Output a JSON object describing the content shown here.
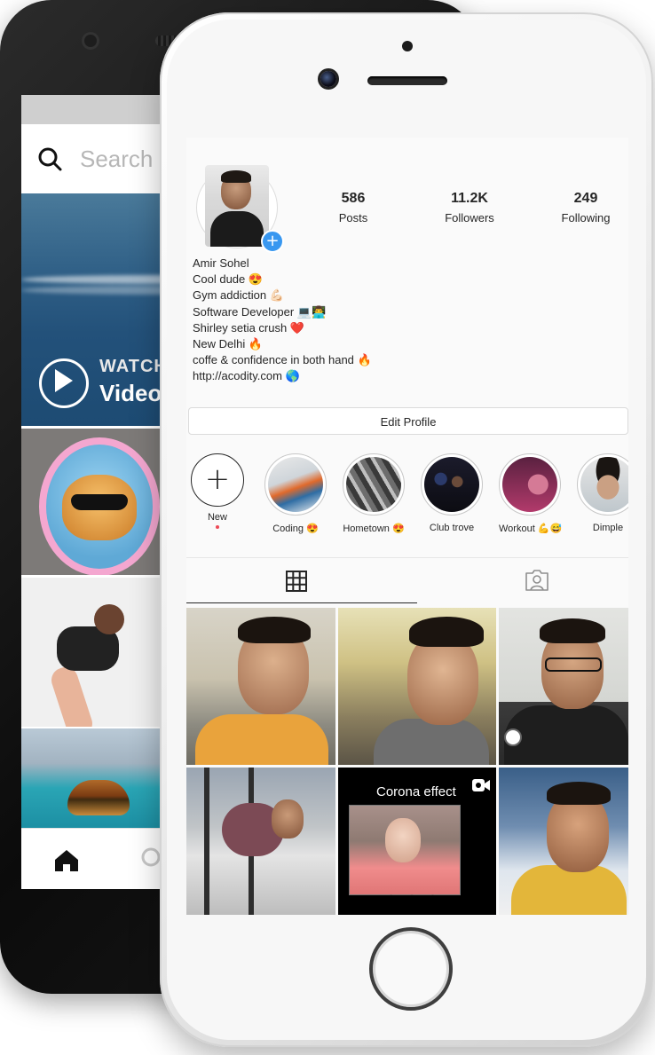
{
  "back_phone": {
    "search_placeholder": "Search",
    "video_overlay": {
      "watch": "WATCH",
      "title": "Video"
    }
  },
  "profile": {
    "stats": [
      {
        "value": "586",
        "label": "Posts"
      },
      {
        "value": "11.2K",
        "label": "Followers"
      },
      {
        "value": "249",
        "label": "Following"
      }
    ],
    "bio": [
      "Amir Sohel",
      "Cool dude 😍",
      "Gym addiction 💪🏻",
      "Software Developer 💻👨‍💻",
      "Shirley setia crush ❤️",
      "New Delhi 🔥",
      "coffe & confidence in both hand 🔥",
      "http://acodity.com 🌎"
    ],
    "edit_button": "Edit Profile",
    "highlights": [
      {
        "label": "New"
      },
      {
        "label": "Coding 😍"
      },
      {
        "label": "Hometown 😍"
      },
      {
        "label": "Club trove"
      },
      {
        "label": "Workout 💪😅"
      },
      {
        "label": "Dimple"
      }
    ],
    "tabs": [
      {
        "name": "grid",
        "icon": "grid-icon",
        "active": true
      },
      {
        "name": "tagged",
        "icon": "tagged-person-icon",
        "active": false
      }
    ],
    "posts": [
      {
        "caption": ""
      },
      {
        "caption": ""
      },
      {
        "caption": ""
      },
      {
        "caption": ""
      },
      {
        "caption": "Corona effect",
        "emoji": "😂😂😂"
      },
      {
        "caption": ""
      }
    ]
  },
  "colors": {
    "accent_blue": "#3897f0",
    "text_dark": "#262626",
    "notification_red": "#ed4956"
  }
}
